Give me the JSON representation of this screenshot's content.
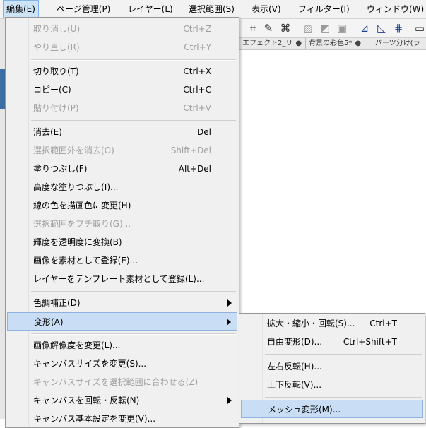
{
  "menubar": {
    "items": [
      "編集(E)",
      "ページ管理(P)",
      "レイヤー(L)",
      "選択範囲(S)",
      "表示(V)",
      "フィルター(I)",
      "ウィンドウ(W)"
    ]
  },
  "tabs": [
    "エフェクト2_リ",
    "背景の彩色5*",
    "パーツ分け(ラ"
  ],
  "toolbar_icons": [
    "selection-icon",
    "brush-icon",
    "transform-icon",
    "pattern-icon",
    "pattern-icon",
    "pattern-icon",
    "ruler-icon",
    "ruler-icon",
    "grid-icon",
    "window-icon"
  ],
  "edit_menu": {
    "items": [
      {
        "label": "取り消し(U)",
        "shortcut": "Ctrl+Z",
        "enabled": false
      },
      {
        "label": "やり直し(R)",
        "shortcut": "Ctrl+Y",
        "enabled": false
      },
      {
        "label": "切り取り(T)",
        "shortcut": "Ctrl+X",
        "enabled": true
      },
      {
        "label": "コピー(C)",
        "shortcut": "Ctrl+C",
        "enabled": true
      },
      {
        "label": "貼り付け(P)",
        "shortcut": "Ctrl+V",
        "enabled": false
      },
      {
        "label": "消去(E)",
        "shortcut": "Del",
        "enabled": true
      },
      {
        "label": "選択範囲外を消去(O)",
        "shortcut": "Shift+Del",
        "enabled": false
      },
      {
        "label": "塗りつぶし(F)",
        "shortcut": "Alt+Del",
        "enabled": true
      },
      {
        "label": "高度な塗りつぶし(I)...",
        "shortcut": "",
        "enabled": true
      },
      {
        "label": "線の色を描画色に変更(H)",
        "shortcut": "",
        "enabled": true
      },
      {
        "label": "選択範囲をフチ取り(G)...",
        "shortcut": "",
        "enabled": false
      },
      {
        "label": "輝度を透明度に変換(B)",
        "shortcut": "",
        "enabled": true
      },
      {
        "label": "画像を素材として登録(E)...",
        "shortcut": "",
        "enabled": true
      },
      {
        "label": "レイヤーをテンプレート素材として登録(L)...",
        "shortcut": "",
        "enabled": true
      },
      {
        "label": "色調補正(D)",
        "shortcut": "",
        "enabled": true,
        "submenu": true
      },
      {
        "label": "変形(A)",
        "shortcut": "",
        "enabled": true,
        "submenu": true,
        "highlighted": true
      },
      {
        "label": "画像解像度を変更(L)...",
        "shortcut": "",
        "enabled": true
      },
      {
        "label": "キャンバスサイズを変更(S)...",
        "shortcut": "",
        "enabled": true
      },
      {
        "label": "キャンバスサイズを選択範囲に合わせる(Z)",
        "shortcut": "",
        "enabled": false
      },
      {
        "label": "キャンバスを回転・反転(N)",
        "shortcut": "",
        "enabled": true,
        "submenu": true
      },
      {
        "label": "キャンバス基本設定を変更(V)...",
        "shortcut": "",
        "enabled": true
      }
    ]
  },
  "transform_submenu": {
    "items": [
      {
        "label": "拡大・縮小・回転(S)...",
        "shortcut": "Ctrl+T"
      },
      {
        "label": "自由変形(D)...",
        "shortcut": "Ctrl+Shift+T"
      },
      {
        "label": "左右反転(H)...",
        "shortcut": ""
      },
      {
        "label": "上下反転(V)...",
        "shortcut": ""
      },
      {
        "label": "メッシュ変形(M)...",
        "shortcut": "",
        "highlighted": true
      }
    ]
  },
  "colors": {
    "highlight": "#c9def5",
    "highlight_border": "#8fb3de",
    "disabled_text": "#a0a0a0",
    "menu_bg": "#f0f0f0"
  }
}
